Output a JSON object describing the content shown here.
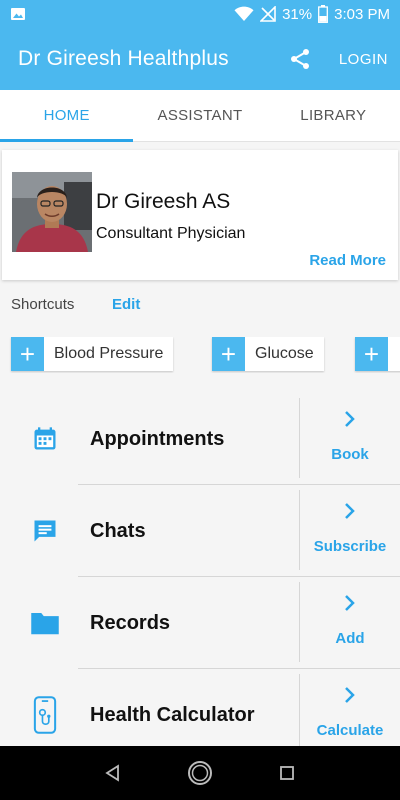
{
  "status_bar": {
    "battery": "31%",
    "time": "3:03 PM",
    "icons": [
      "image-icon",
      "wifi-icon",
      "no-signal-icon",
      "battery-icon"
    ]
  },
  "app_bar": {
    "title": "Dr Gireesh Healthplus",
    "login_label": "LOGIN",
    "share_icon": "share-icon"
  },
  "tabs": [
    {
      "label": "HOME",
      "active": true
    },
    {
      "label": "ASSISTANT",
      "active": false
    },
    {
      "label": "LIBRARY",
      "active": false
    }
  ],
  "profile": {
    "name": "Dr Gireesh AS",
    "title": "Consultant Physician",
    "read_more": "Read More"
  },
  "shortcuts": {
    "label": "Shortcuts",
    "edit_label": "Edit",
    "items": [
      {
        "label": "Blood Pressure"
      },
      {
        "label": "Glucose"
      },
      {
        "label": ""
      }
    ]
  },
  "list": [
    {
      "label": "Appointments",
      "icon": "calendar-icon",
      "action": "Book"
    },
    {
      "label": "Chats",
      "icon": "chat-icon",
      "action": "Subscribe"
    },
    {
      "label": "Records",
      "icon": "folder-icon",
      "action": "Add"
    },
    {
      "label": "Health Calculator",
      "icon": "phone-calculator-icon",
      "action": "Calculate"
    }
  ],
  "colors": {
    "primary": "#4bb8ef",
    "accent": "#2aa4e8"
  }
}
